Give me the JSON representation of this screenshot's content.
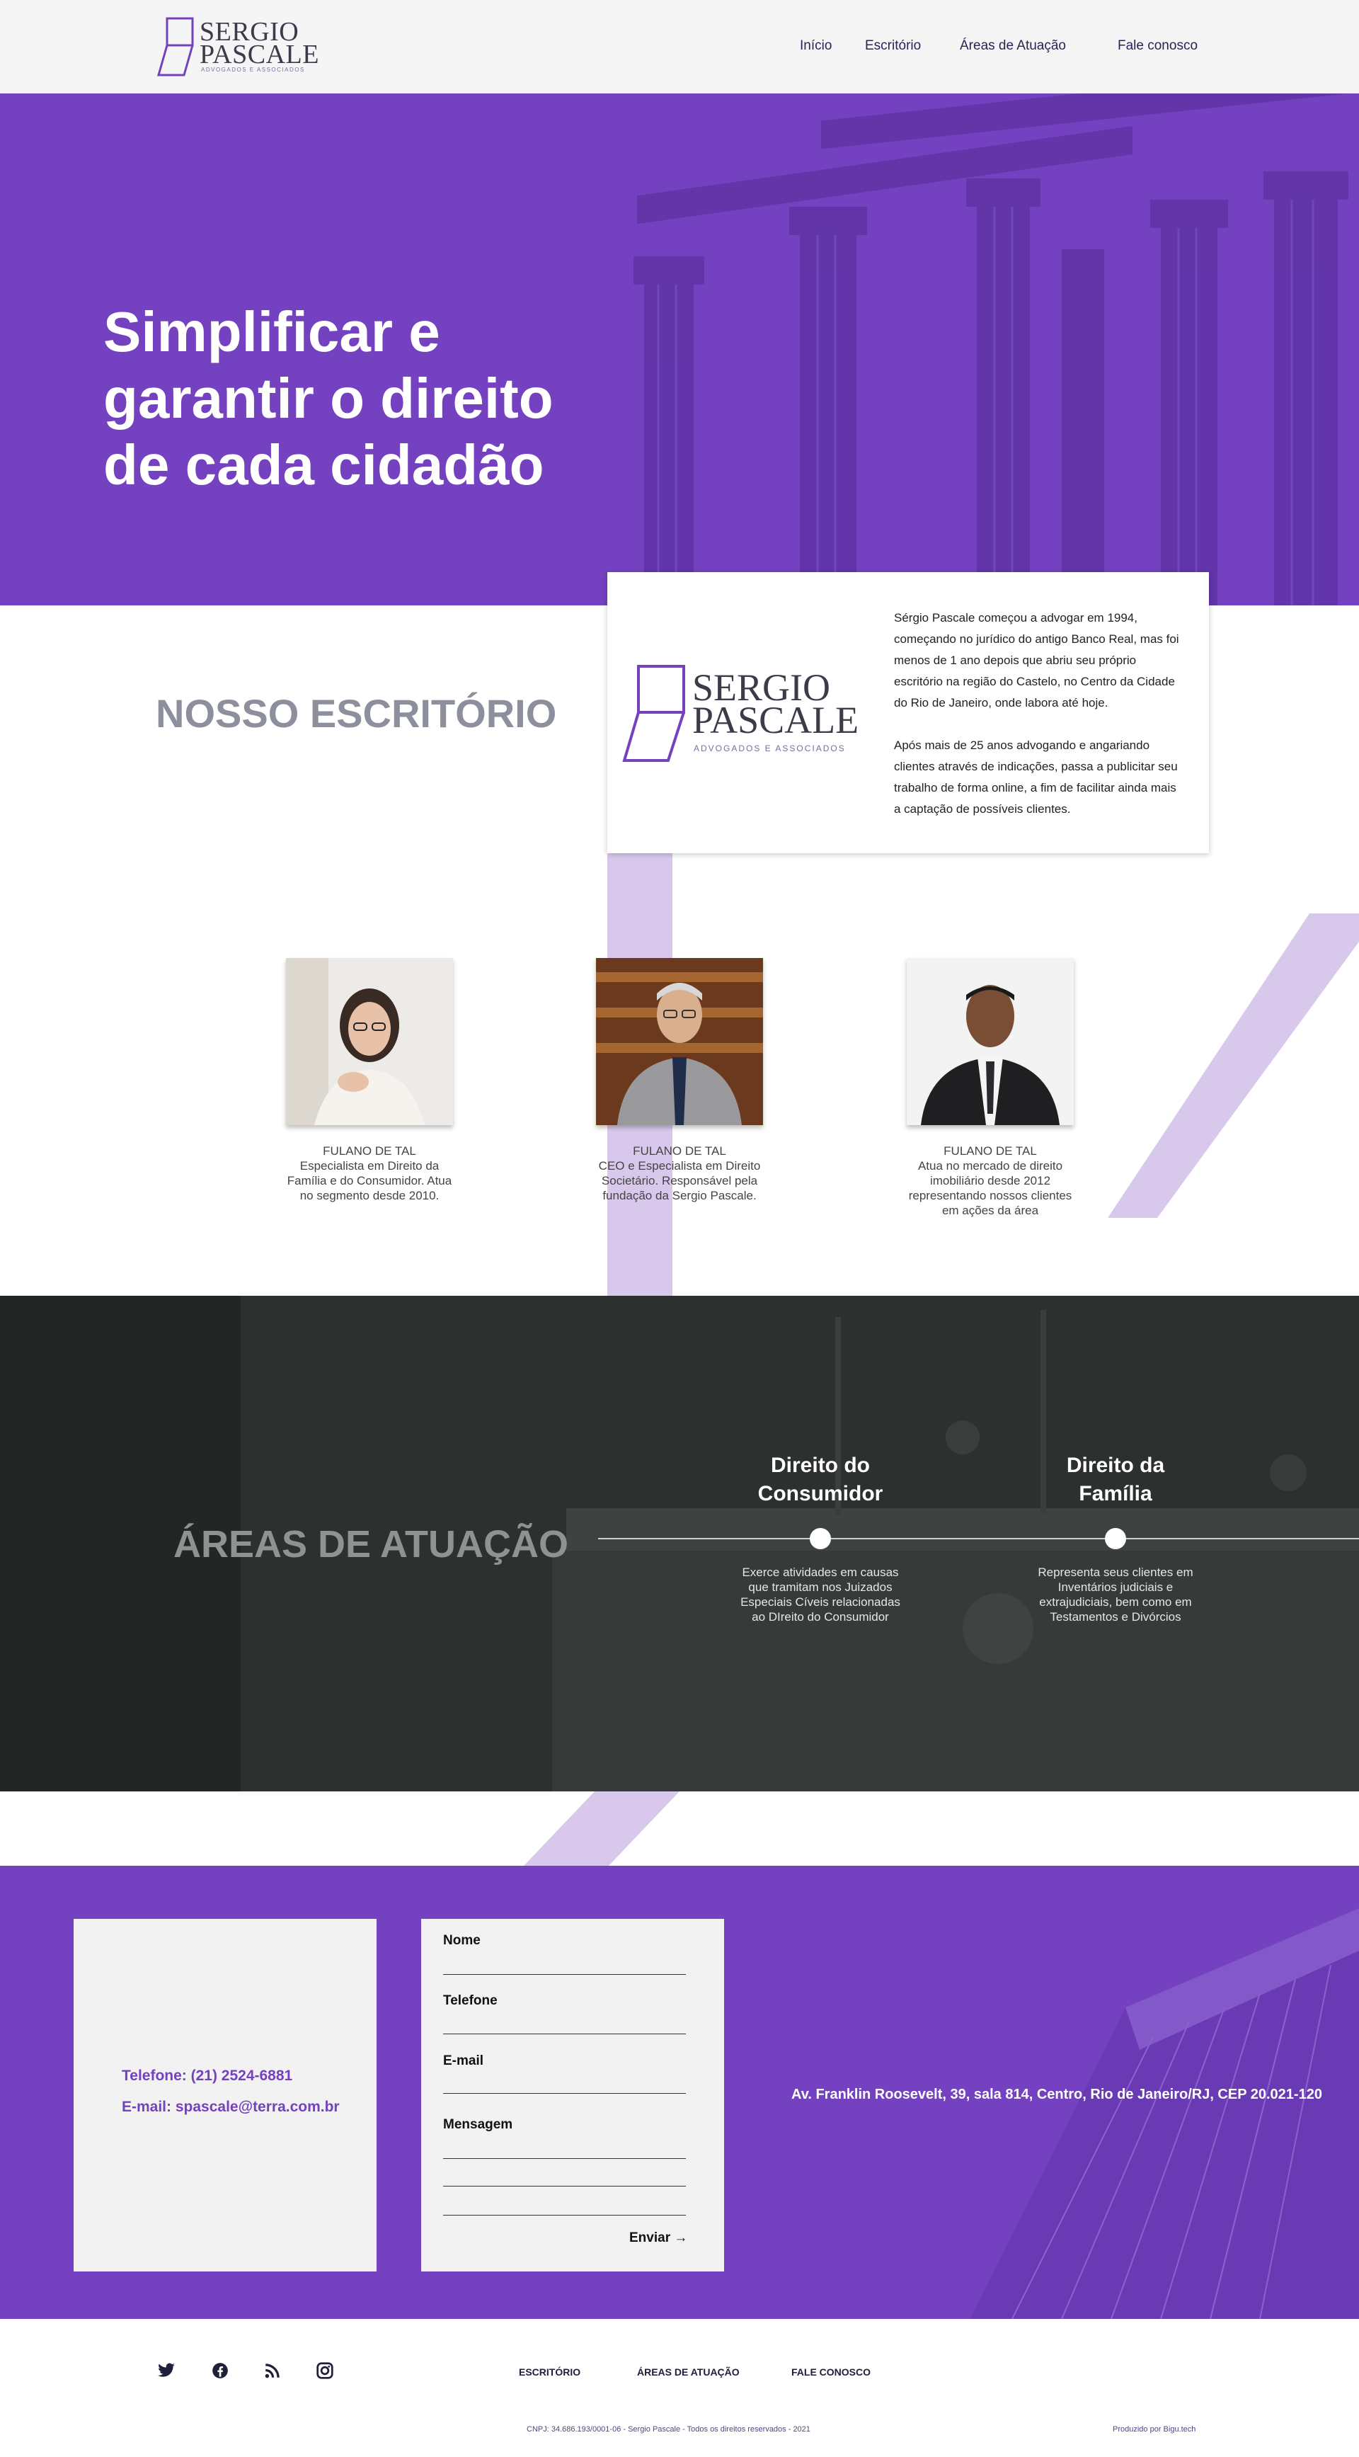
{
  "colors": {
    "brand_purple": "#7442c0",
    "light_purple": "#d8c9ec",
    "dark_bg": "#2c302e",
    "heading_gray": "#8d8f9c"
  },
  "header": {
    "logo": {
      "line1": "SERGIO",
      "line2": "PASCALE",
      "sub": "ADVOGADOS E ASSOCIADOS"
    },
    "nav": [
      "Início",
      "Escritório",
      "Áreas de Atuação",
      "Fale conosco"
    ]
  },
  "hero": {
    "title": "Simplificar e garantir o direito de cada cidadão"
  },
  "office": {
    "title": "NOSSO ESCRITÓRIO",
    "card_logo": {
      "line1": "SERGIO",
      "line2": "PASCALE",
      "sub": "ADVOGADOS E ASSOCIADOS"
    },
    "paragraphs": [
      "Sérgio Pascale começou a advogar em 1994, começando no jurídico do antigo Banco Real, mas foi menos de 1 ano depois que abriu seu próprio escritório na região do Castelo, no Centro da Cidade do Rio de Janeiro, onde labora até hoje.",
      "Após mais de 25 anos advogando e angariando clientes através de indicações, passa a publicitar seu trabalho de forma online, a fim de facilitar ainda mais a captação de possíveis clientes."
    ],
    "team": [
      {
        "name": "FULANO DE TAL",
        "desc": "Especialista em Direito da Família e do Consumidor. Atua no segmento desde 2010."
      },
      {
        "name": "FULANO DE TAL",
        "desc": "CEO e Especialista em Direito Societário. Responsável pela fundação da Sergio Pascale."
      },
      {
        "name": "FULANO DE TAL",
        "desc": "Atua no mercado de direito imobiliário desde 2012 representando nossos clientes em ações da área"
      }
    ]
  },
  "areas": {
    "title": "ÁREAS DE ATUAÇÃO",
    "items": [
      {
        "name": "Direito do Consumidor",
        "desc": "Exerce atividades em causas que tramitam nos Juizados Especiais Cíveis relacionadas ao DIreito do Consumidor"
      },
      {
        "name": "Direito da Família",
        "desc": "Representa seus clientes em Inventários judiciais e extrajudiciais, bem como em Testamentos e Divórcios"
      }
    ]
  },
  "contact": {
    "phone": "Telefone: (21) 2524-6881",
    "email": "E-mail: spascale@terra.com.br",
    "form": {
      "name": "Nome",
      "phone": "Telefone",
      "email": "E-mail",
      "message": "Mensagem",
      "send": "Enviar"
    },
    "address": "Av. Franklin Roosevelt, 39, sala 814, Centro, Rio de Janeiro/RJ, CEP 20.021-120"
  },
  "footer": {
    "social_icons": [
      "twitter-icon",
      "facebook-icon",
      "rss-icon",
      "instagram-icon"
    ],
    "links": [
      "ESCRITÓRIO",
      "ÁREAS DE ATUAÇÃO",
      "FALE CONOSCO"
    ],
    "legal": "CNPJ: 34.686.193/0001-06 - Sergio Pascale - Todos os direitos reservados - 2021",
    "credit": "Produzido por Bigu.tech"
  }
}
